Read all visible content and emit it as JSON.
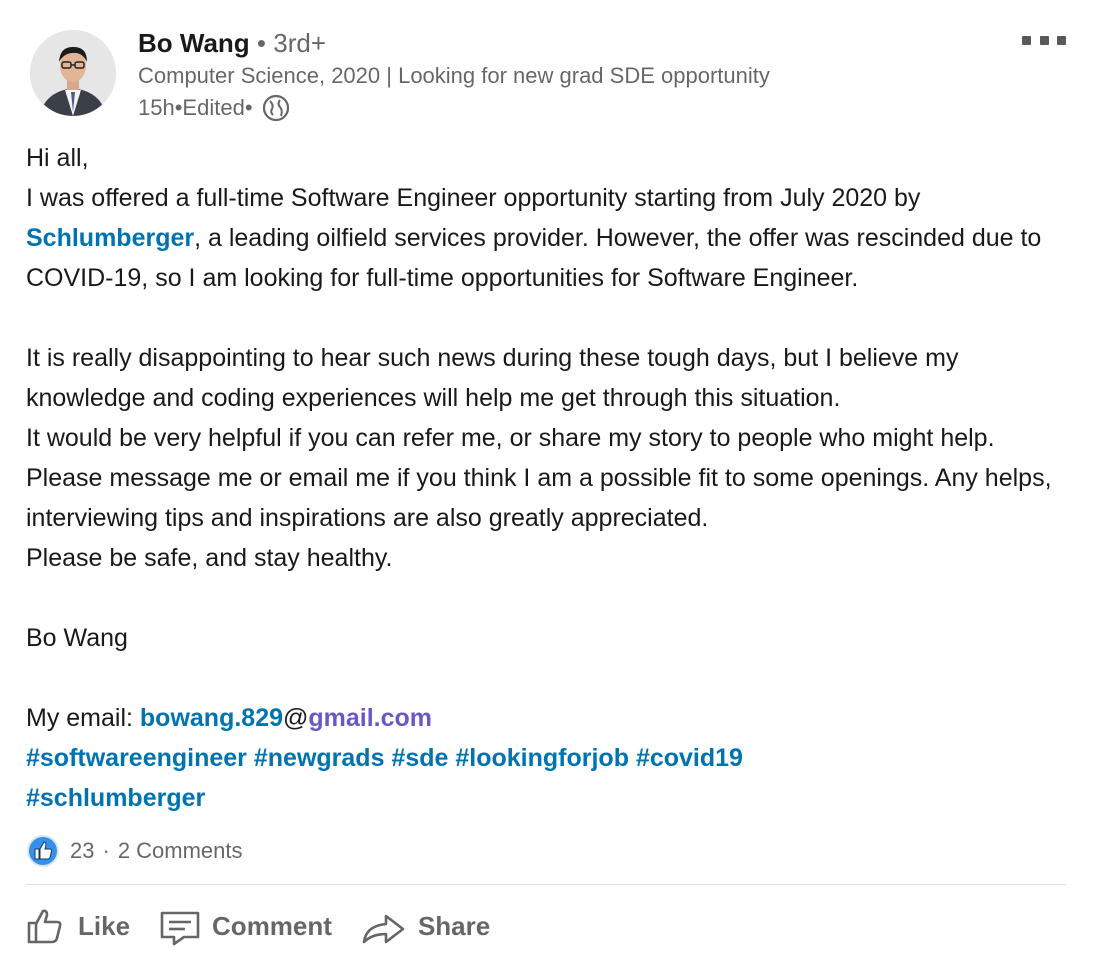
{
  "author": {
    "name": "Bo Wang",
    "degree_sep": " • ",
    "degree": "3rd+",
    "headline": "Computer Science, 2020 | Looking for new grad SDE opportunity",
    "time": "15h",
    "edited": "Edited",
    "meta_sep": " • "
  },
  "post": {
    "greeting": "Hi all,",
    "p1_before": "I was offered a full-time Software Engineer opportunity starting from July 2020 by ",
    "company_link": "Schlumberger",
    "p1_after": ", a leading oilfield services provider. However, the offer was rescinded due to COVID-19, so I am looking for full-time opportunities for Software Engineer.",
    "p2": "It is really disappointing to hear such news during these tough days, but I believe my knowledge and coding experiences will help me get through this situation.",
    "p3": "It would be very helpful if you can refer me, or share my story to people who might help. Please message me or email me if you think I am a possible fit to some openings. Any helps, interviewing tips and inspirations are also greatly appreciated.",
    "p4": "Please be safe, and stay healthy.",
    "signature": "Bo Wang",
    "email_label": "My email: ",
    "email_user": "bowang.829",
    "email_at": "@",
    "email_domain": "gmail.com",
    "hashtags": [
      "#softwareengineer",
      "#newgrads",
      "#sde",
      "#lookingforjob",
      "#covid19",
      "#schlumberger"
    ]
  },
  "social": {
    "reactions": "23",
    "sep": "·",
    "comments": "2 Comments"
  },
  "actions": {
    "like": "Like",
    "comment": "Comment",
    "share": "Share"
  },
  "icons": {
    "more": "more-icon",
    "globe": "globe-icon",
    "like_badge": "like-badge-icon",
    "like": "thumbs-up-icon",
    "comment": "comment-icon",
    "share": "share-icon"
  },
  "colors": {
    "link": "#0073b1",
    "email_domain": "#6c58c4",
    "secondary_text": "#666666"
  }
}
